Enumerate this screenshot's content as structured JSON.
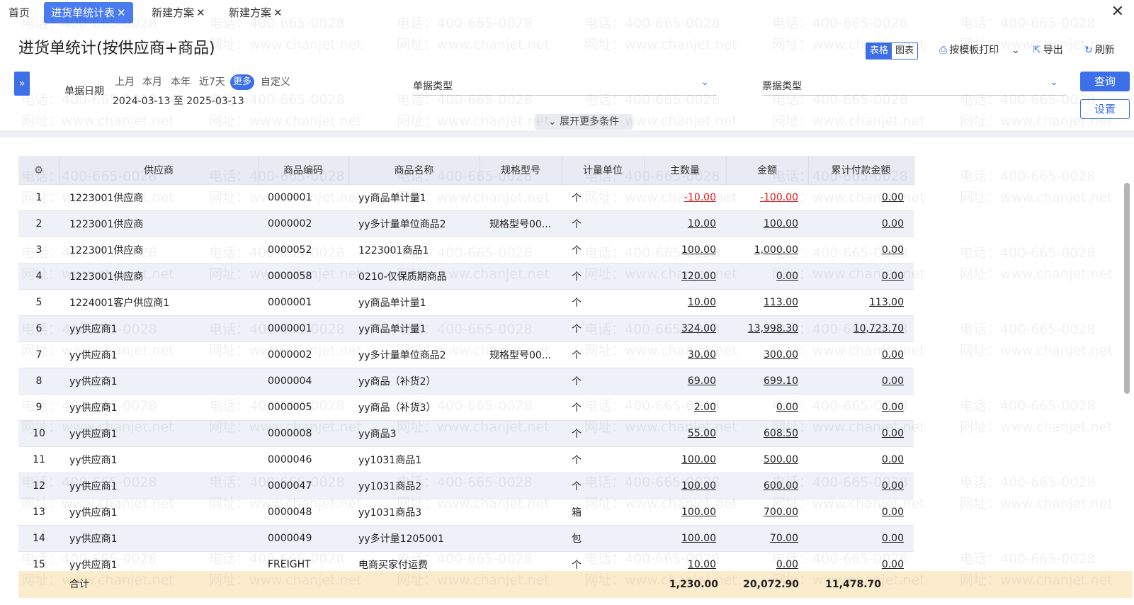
{
  "tabs": [
    {
      "label": "首页",
      "active": false,
      "closable": false
    },
    {
      "label": "进货单统计表",
      "active": true,
      "closable": true
    },
    {
      "label": "新建方案",
      "active": false,
      "closable": true
    },
    {
      "label": "新建方案",
      "active": false,
      "closable": true
    }
  ],
  "tab_close_glyph": "✕",
  "window_close_glyph": "✕",
  "page": {
    "title": "进货单统计(按供应商+商品)"
  },
  "view_toggle": {
    "table": "表格",
    "chart": "图表",
    "selected": "表格"
  },
  "actions": {
    "print": "按模板打印",
    "print_icon": "printer-icon",
    "export": "导出",
    "export_icon": "export-icon",
    "refresh": "刷新",
    "refresh_icon": "refresh-icon"
  },
  "filters": {
    "date_label": "单据日期",
    "date_presets": [
      "上月",
      "本月",
      "本年",
      "近7天",
      "更多",
      "自定义"
    ],
    "date_selected": "更多",
    "date_range": "2024-03-13 至 2025-03-13",
    "doc_type_label": "单据类型",
    "doc_type_value": "",
    "ticket_type_label": "票据类型",
    "ticket_type_value": "",
    "expand_more": "展开更多条件",
    "query_button": "查询",
    "settings_button": "设置"
  },
  "table": {
    "columns": [
      "供应商",
      "商品编码",
      "商品名称",
      "规格型号",
      "计量单位",
      "主数量",
      "金额",
      "累计付款金额"
    ],
    "rows": [
      {
        "no": "1",
        "supplier": "1223001供应商",
        "code": "0000001",
        "name": "yy商品单计量1",
        "spec": "",
        "unit": "个",
        "qty": "-10.00",
        "amount": "-100.00",
        "paid": "0.00"
      },
      {
        "no": "2",
        "supplier": "1223001供应商",
        "code": "0000002",
        "name": "yy多计量单位商品2",
        "spec": "规格型号00...",
        "unit": "个",
        "qty": "10.00",
        "amount": "100.00",
        "paid": "0.00"
      },
      {
        "no": "3",
        "supplier": "1223001供应商",
        "code": "0000052",
        "name": "1223001商品1",
        "spec": "",
        "unit": "个",
        "qty": "100.00",
        "amount": "1,000.00",
        "paid": "0.00"
      },
      {
        "no": "4",
        "supplier": "1223001供应商",
        "code": "0000058",
        "name": "0210-仅保质期商品",
        "spec": "",
        "unit": "个",
        "qty": "120.00",
        "amount": "0.00",
        "paid": "0.00"
      },
      {
        "no": "5",
        "supplier": "1224001客户供应商1",
        "code": "0000001",
        "name": "yy商品单计量1",
        "spec": "",
        "unit": "个",
        "qty": "10.00",
        "amount": "113.00",
        "paid": "113.00"
      },
      {
        "no": "6",
        "supplier": "yy供应商1",
        "code": "0000001",
        "name": "yy商品单计量1",
        "spec": "",
        "unit": "个",
        "qty": "324.00",
        "amount": "13,998.30",
        "paid": "10,723.70"
      },
      {
        "no": "7",
        "supplier": "yy供应商1",
        "code": "0000002",
        "name": "yy多计量单位商品2",
        "spec": "规格型号00...",
        "unit": "个",
        "qty": "30.00",
        "amount": "300.00",
        "paid": "0.00"
      },
      {
        "no": "8",
        "supplier": "yy供应商1",
        "code": "0000004",
        "name": "yy商品（补货2）",
        "spec": "",
        "unit": "个",
        "qty": "69.00",
        "amount": "699.10",
        "paid": "0.00"
      },
      {
        "no": "9",
        "supplier": "yy供应商1",
        "code": "0000005",
        "name": "yy商品（补货3）",
        "spec": "",
        "unit": "个",
        "qty": "2.00",
        "amount": "0.00",
        "paid": "0.00"
      },
      {
        "no": "10",
        "supplier": "yy供应商1",
        "code": "0000008",
        "name": "yy商品3",
        "spec": "",
        "unit": "个",
        "qty": "55.00",
        "amount": "608.50",
        "paid": "0.00"
      },
      {
        "no": "11",
        "supplier": "yy供应商1",
        "code": "0000046",
        "name": "yy1031商品1",
        "spec": "",
        "unit": "个",
        "qty": "100.00",
        "amount": "500.00",
        "paid": "0.00"
      },
      {
        "no": "12",
        "supplier": "yy供应商1",
        "code": "0000047",
        "name": "yy1031商品2",
        "spec": "",
        "unit": "个",
        "qty": "100.00",
        "amount": "600.00",
        "paid": "0.00"
      },
      {
        "no": "13",
        "supplier": "yy供应商1",
        "code": "0000048",
        "name": "yy1031商品3",
        "spec": "",
        "unit": "箱",
        "qty": "100.00",
        "amount": "700.00",
        "paid": "0.00"
      },
      {
        "no": "14",
        "supplier": "yy供应商1",
        "code": "0000049",
        "name": "yy多计量1205001",
        "spec": "",
        "unit": "包",
        "qty": "100.00",
        "amount": "70.00",
        "paid": "0.00"
      },
      {
        "no": "15",
        "supplier": "yy供应商1",
        "code": "FREIGHT",
        "name": "电商买家付运费",
        "spec": "",
        "unit": "个",
        "qty": "10.00",
        "amount": "0.00",
        "paid": "0.00"
      }
    ],
    "totals": {
      "label": "合计",
      "qty": "1,230.00",
      "amount": "20,072.90",
      "paid": "11,478.70"
    }
  },
  "watermark": {
    "phone": "电话：400-665-0028",
    "site": "网址：www.chanjet.net"
  },
  "colors": {
    "accent": "#3d6fe8",
    "negative": "#e02020",
    "header_bg": "#e8ebf4",
    "total_bg": "#fbeccd"
  }
}
